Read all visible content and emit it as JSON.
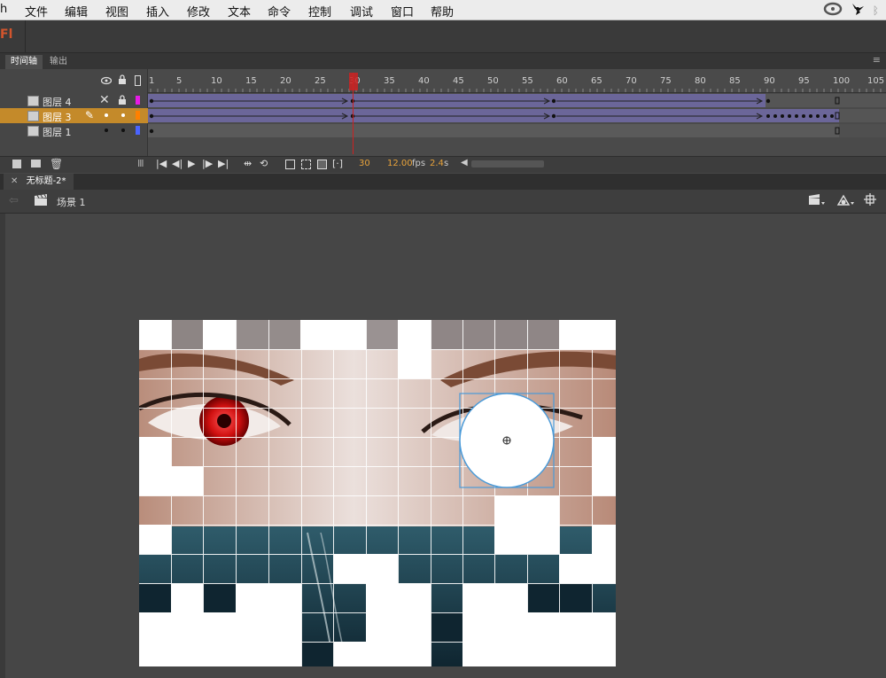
{
  "menu": {
    "app_fragment": "h",
    "items": [
      "文件",
      "编辑",
      "视图",
      "插入",
      "修改",
      "文本",
      "命令",
      "控制",
      "调试",
      "窗口",
      "帮助"
    ]
  },
  "app_logo": "Fl",
  "panel_tabs": [
    "时间轴",
    "输出"
  ],
  "timeline": {
    "ruler_labels": [
      "1",
      "5",
      "10",
      "15",
      "20",
      "25",
      "30",
      "35",
      "40",
      "45",
      "50",
      "55",
      "60",
      "65",
      "70",
      "75",
      "80",
      "85",
      "90",
      "95",
      "100",
      "105"
    ],
    "current_frame": "30",
    "fps": "12.00",
    "fps_unit": "fps",
    "time": "2.4",
    "time_unit": "s",
    "layers": [
      {
        "name": "图层 4",
        "color": "#e61be6",
        "selected": false
      },
      {
        "name": "图层 3",
        "color": "#ff8000",
        "selected": true
      },
      {
        "name": "图层 1",
        "color": "#4a64ff",
        "selected": false
      }
    ]
  },
  "document": {
    "tab_title": "无标题-2*",
    "scene": "场景 1"
  },
  "colors": {
    "selected_layer": "#c48a2a",
    "tween_fill": "#6b6699",
    "playhead": "#cc2222",
    "fps_text": "#e8a33b"
  }
}
